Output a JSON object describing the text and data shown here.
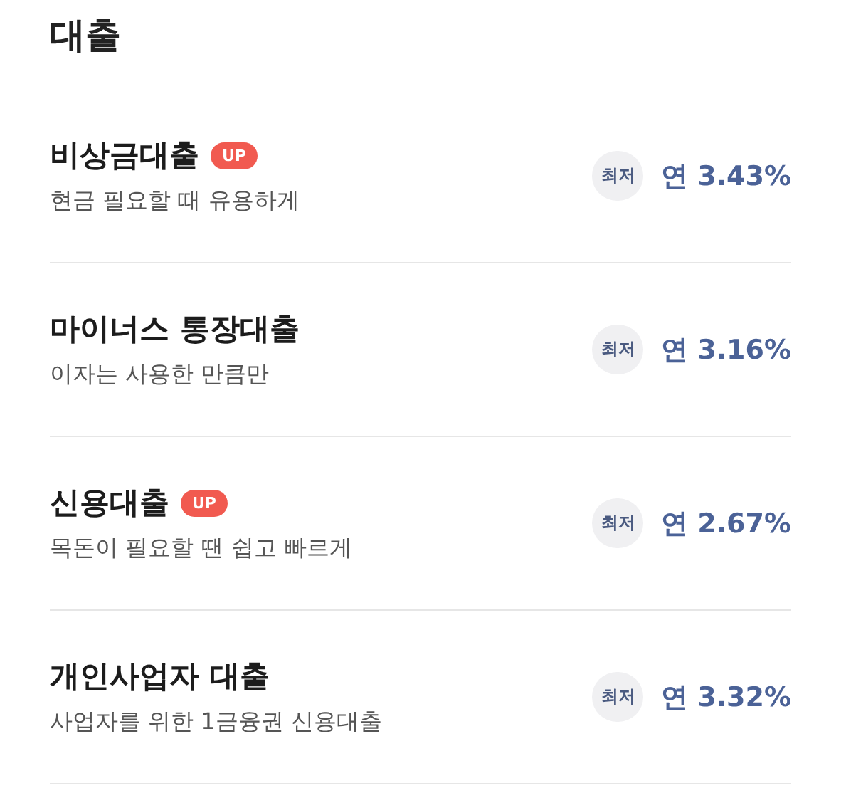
{
  "heading": "대출",
  "loans": [
    {
      "title": "비상금대출",
      "up_badge": "UP",
      "subtitle": "현금 필요할 때 유용하게",
      "tag": "최저",
      "rate": "연 3.43%"
    },
    {
      "title": "마이너스 통장대출",
      "subtitle": "이자는 사용한 만큼만",
      "tag": "최저",
      "rate": "연 3.16%"
    },
    {
      "title": "신용대출",
      "up_badge": "UP",
      "subtitle": "목돈이 필요할 땐 쉽고 빠르게",
      "tag": "최저",
      "rate": "연 2.67%"
    },
    {
      "title": "개인사업자 대출",
      "subtitle": "사업자를 위한 1금융권 신용대출",
      "tag": "최저",
      "rate": "연 3.32%"
    }
  ]
}
